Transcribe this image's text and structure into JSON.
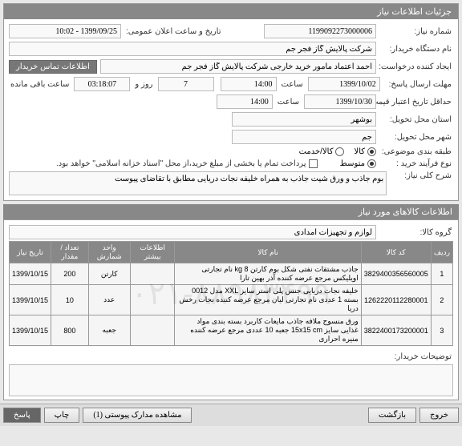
{
  "header": {
    "title": "جزئیات اطلاعات نیاز"
  },
  "fields": {
    "need_no_label": "شماره نیاز:",
    "need_no": "1199092273000006",
    "public_date_label": "تاریخ و ساعت اعلان عمومی:",
    "public_date": "1399/09/25 - 10:02",
    "buyer_label": "نام دستگاه خریدار:",
    "buyer": "شرکت پالایش گاز فجر جم",
    "creator_label": "ایجاد کننده درخواست:",
    "creator": "احمد اعتماد مامور خرید خارجی شرکت پالایش گاز فجر جم",
    "contact_btn": "اطلاعات تماس خریدار",
    "deadline_label": "مهلت ارسال پاسخ:",
    "deadline_date": "1399/10/02",
    "hour_label": "ساعت",
    "deadline_time": "14:00",
    "countdown_days": "7",
    "days_label": "روز و",
    "countdown_time": "03:18:07",
    "remain_label": "ساعت باقی مانده",
    "validity_label": "حداقل تاریخ اعتبار قیمت: تا تاریخ:",
    "validity_date": "1399/10/30",
    "validity_time": "14:00",
    "province_label": "استان محل تحویل:",
    "province": "بوشهر",
    "city_label": "شهر محل تحویل:",
    "city": "جم",
    "budget_label": "طبقه بندی موضوعی:",
    "budget_opts": [
      "کالا",
      "کالا/خدمت"
    ],
    "purchase_type_label": "نوع فرآیند خرید :",
    "purchase_opts": [
      "متوسط"
    ],
    "partial_label": "پرداخت تمام یا بخشی از مبلغ خرید،از محل \"اسناد خزانه اسلامی\" خواهد بود.",
    "desc_label": "شرح کلی نیاز:",
    "desc": "بوم جاذب و ورق شیت جاذب به همراه خلیفه نجات دریایی مطابق با تقاضای پیوست"
  },
  "goods_header": "اطلاعات کالاهای مورد نیاز",
  "group_label": "گروه کالا:",
  "group_value": "لوازم و تجهیزات امدادی",
  "table": {
    "headers": [
      "ردیف",
      "کد کالا",
      "نام کالا",
      "اطلاعات بیشتر",
      "واحد شمارش",
      "تعداد / مقدار",
      "تاریخ نیاز"
    ],
    "rows": [
      {
        "idx": "1",
        "code": "3829400356560005",
        "name": "جاذب مشتقات نفتی شکل بوم کارتن kg 8 نام تجارتی اویلیکس مرجع عرضه کننده آذر بهین تارا",
        "unit": "کارتن",
        "qty": "200",
        "date": "1399/10/15"
      },
      {
        "idx": "2",
        "code": "1262220112280001",
        "name": "خلیفه نجات دریایی جنس پلی استر سایز XXL مدل 0012 بسته 1 عددی نام تجارتی لیان مرجع عرضه کننده نجات رخش دریا",
        "unit": "عدد",
        "qty": "10",
        "date": "1399/10/15"
      },
      {
        "idx": "3",
        "code": "3822400173200001",
        "name": "ورق منسوج ملافه جاذب مایعات کاربرد بسته بندی مواد غذایی سایز 15x15 cm جعبه 10 عددی مرجع عرضه کننده منیره احراری",
        "unit": "جعبه",
        "qty": "800",
        "date": "1399/10/15"
      }
    ]
  },
  "comments_label": "توضیحات خریدار:",
  "footer": {
    "exit": "خروج",
    "back": "بازگشت",
    "attach": "مشاهده مدارک پیوستی (1)",
    "print": "چاپ",
    "reply": "پاسخ"
  },
  "watermark": "۰۲۱-۸۸۹۸۳۴۹۹"
}
